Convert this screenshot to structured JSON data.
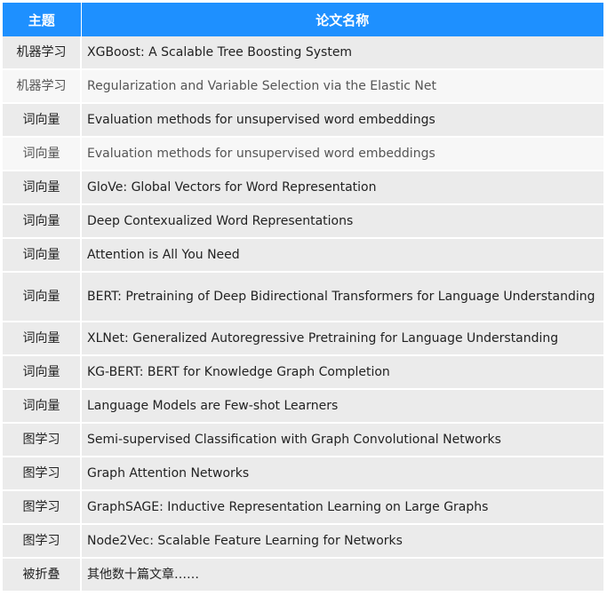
{
  "colors": {
    "header_bg": "#1e90ff",
    "header_text": "#ffffff",
    "row_gray": "#ebebeb",
    "row_light": "#f7f7f7"
  },
  "table": {
    "headers": [
      "主题",
      "论文名称"
    ],
    "rows": [
      {
        "topic": "机器学习",
        "title": "XGBoost: A Scalable Tree Boosting System"
      },
      {
        "topic": "机器学习",
        "title": "Regularization and Variable Selection via the Elastic Net"
      },
      {
        "topic": "词向量",
        "title": "Evaluation methods for unsupervised word embeddings"
      },
      {
        "topic": "词向量",
        "title": "Evaluation methods for unsupervised word embeddings"
      },
      {
        "topic": "词向量",
        "title": "GloVe: Global Vectors for Word Representation"
      },
      {
        "topic": "词向量",
        "title": "Deep Contexualized Word Representations"
      },
      {
        "topic": "词向量",
        "title": "Attention is All You Need"
      },
      {
        "topic": "词向量",
        "title": "BERT: Pretraining of Deep Bidirectional Transformers for Language Understanding"
      },
      {
        "topic": "词向量",
        "title": "XLNet: Generalized Autoregressive Pretraining for Language Understanding"
      },
      {
        "topic": "词向量",
        "title": "KG-BERT: BERT for Knowledge Graph Completion"
      },
      {
        "topic": "词向量",
        "title": "Language Models are Few-shot Learners"
      },
      {
        "topic": "图学习",
        "title": "Semi-supervised Classification with Graph Convolutional Networks"
      },
      {
        "topic": "图学习",
        "title": "Graph Attention Networks"
      },
      {
        "topic": "图学习",
        "title": "GraphSAGE: Inductive Representation Learning on Large Graphs"
      },
      {
        "topic": "图学习",
        "title": "Node2Vec: Scalable Feature Learning for Networks"
      },
      {
        "topic": "被折叠",
        "title": "其他数十篇文章……"
      }
    ]
  }
}
